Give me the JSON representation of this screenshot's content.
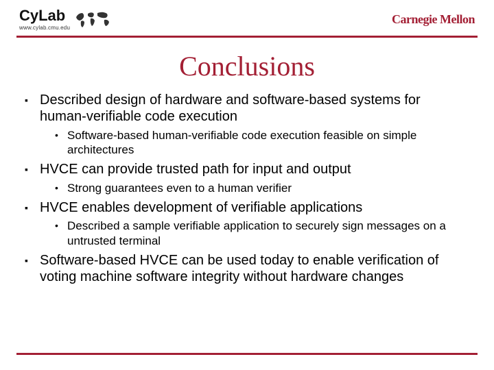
{
  "header": {
    "logo_text": "CyLab",
    "logo_sub": "www.cylab.cmu.edu",
    "university": "Carnegie Mellon"
  },
  "title": "Conclusions",
  "bullets": [
    {
      "text": "Described design of hardware and software-based systems for human-verifiable code execution",
      "sub": [
        "Software-based human-verifiable code execution feasible on simple architectures"
      ]
    },
    {
      "text": "HVCE can provide trusted path for input and output",
      "sub": [
        "Strong guarantees even to a human verifier"
      ]
    },
    {
      "text": "HVCE enables development of verifiable applications",
      "sub": [
        "Described a sample verifiable application to securely sign messages on a untrusted terminal"
      ]
    },
    {
      "text": "Software-based HVCE can be used today to enable verification of voting machine software integrity without hardware changes",
      "sub": []
    }
  ]
}
